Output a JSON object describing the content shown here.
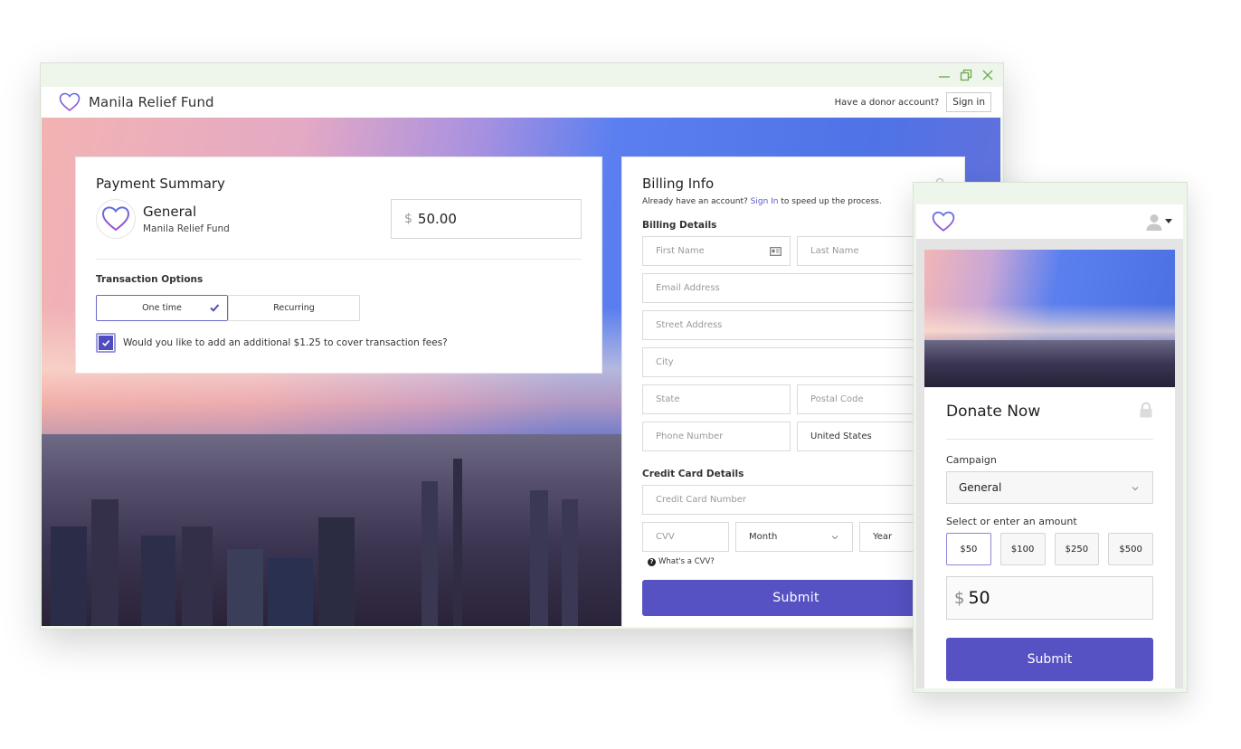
{
  "window": {
    "controls": [
      "minimize",
      "restore",
      "close"
    ],
    "app_title": "Manila Relief Fund",
    "donor_question": "Have a donor account?",
    "signin_label": "Sign in"
  },
  "payment_summary": {
    "title": "Payment Summary",
    "campaign_name": "General",
    "campaign_org": "Manila Relief Fund",
    "currency_symbol": "$",
    "amount": "50.00",
    "transaction_options_label": "Transaction Options",
    "options": [
      {
        "label": "One time",
        "selected": true
      },
      {
        "label": "Recurring",
        "selected": false
      }
    ],
    "fee_checkbox_checked": true,
    "fee_text": "Would you like to add an additional $1.25 to cover transaction fees?"
  },
  "billing": {
    "title": "Billing Info",
    "already_prefix": "Already have an account?",
    "signin_link": "Sign In",
    "already_suffix": "to speed up the process.",
    "details_label": "Billing Details",
    "fields": {
      "first_name": "First Name",
      "last_name": "Last Name",
      "email": "Email Address",
      "street": "Street Address",
      "city": "City",
      "state": "State",
      "postal": "Postal Code",
      "phone": "Phone Number",
      "country": "United States"
    },
    "cc_label": "Credit Card Details",
    "cc_number": "Credit Card Number",
    "cvv": "CVV",
    "month": "Month",
    "year": "Year",
    "cvv_help": "What's a CVV?",
    "submit_label": "Submit"
  },
  "mobile": {
    "donate_title": "Donate Now",
    "campaign_label": "Campaign",
    "campaign_value": "General",
    "amount_label": "Select or enter an amount",
    "amount_options": [
      {
        "label": "$50",
        "selected": true
      },
      {
        "label": "$100",
        "selected": false
      },
      {
        "label": "$250",
        "selected": false
      },
      {
        "label": "$500",
        "selected": false
      }
    ],
    "currency_symbol": "$",
    "amount_value": "50",
    "submit_label": "Submit"
  },
  "colors": {
    "accent": "#5652c4",
    "link": "#5b58c7",
    "window_chrome": "#eef5ea",
    "window_controls": "#6aa84f"
  }
}
